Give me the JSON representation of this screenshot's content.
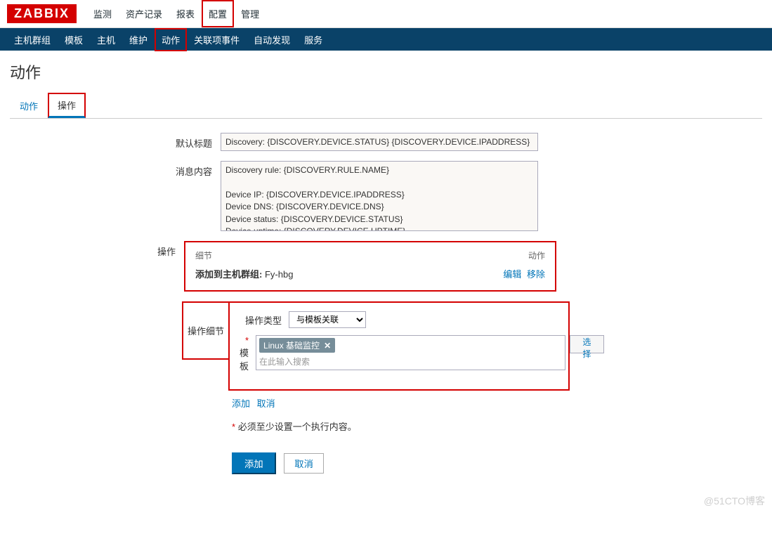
{
  "logo": "ZABBIX",
  "topNav": {
    "items": [
      "监测",
      "资产记录",
      "报表",
      "配置",
      "管理"
    ],
    "highlightIndex": 3
  },
  "subNav": {
    "items": [
      "主机群组",
      "模板",
      "主机",
      "维护",
      "动作",
      "关联项事件",
      "自动发现",
      "服务"
    ],
    "highlightIndex": 4
  },
  "page": {
    "title": "动作",
    "tabs": [
      "动作",
      "操作"
    ],
    "activeHighlightIndex": 1
  },
  "form": {
    "defaultTitleLabel": "默认标题",
    "defaultTitleValue": "Discovery: {DISCOVERY.DEVICE.STATUS} {DISCOVERY.DEVICE.IPADDRESS}",
    "messageLabel": "消息内容",
    "messageValue": "Discovery rule: {DISCOVERY.RULE.NAME}\n\nDevice IP: {DISCOVERY.DEVICE.IPADDRESS}\nDevice DNS: {DISCOVERY.DEVICE.DNS}\nDevice status: {DISCOVERY.DEVICE.STATUS}\nDevice uptime: {DISCOVERY.DEVICE.UPTIME}",
    "opsLabel": "操作",
    "opsHead": {
      "detail": "细节",
      "action": "动作"
    },
    "opsRow": {
      "prefix": "添加到主机群组:",
      "group": "Fy-hbg",
      "edit": "编辑",
      "remove": "移除"
    },
    "detailLabel": "操作细节",
    "detail": {
      "typeLabel": "操作类型",
      "typeValue": "与模板关联",
      "templateLabel": "模板",
      "templateTag": "Linux 基础监控",
      "templatePlaceholder": "在此输入搜索",
      "selectBtn": "选择",
      "addLink": "添加",
      "cancelLink": "取消"
    },
    "note": "必须至少设置一个执行内容。",
    "submit": {
      "add": "添加",
      "cancel": "取消"
    }
  },
  "watermark": "@51CTO博客"
}
